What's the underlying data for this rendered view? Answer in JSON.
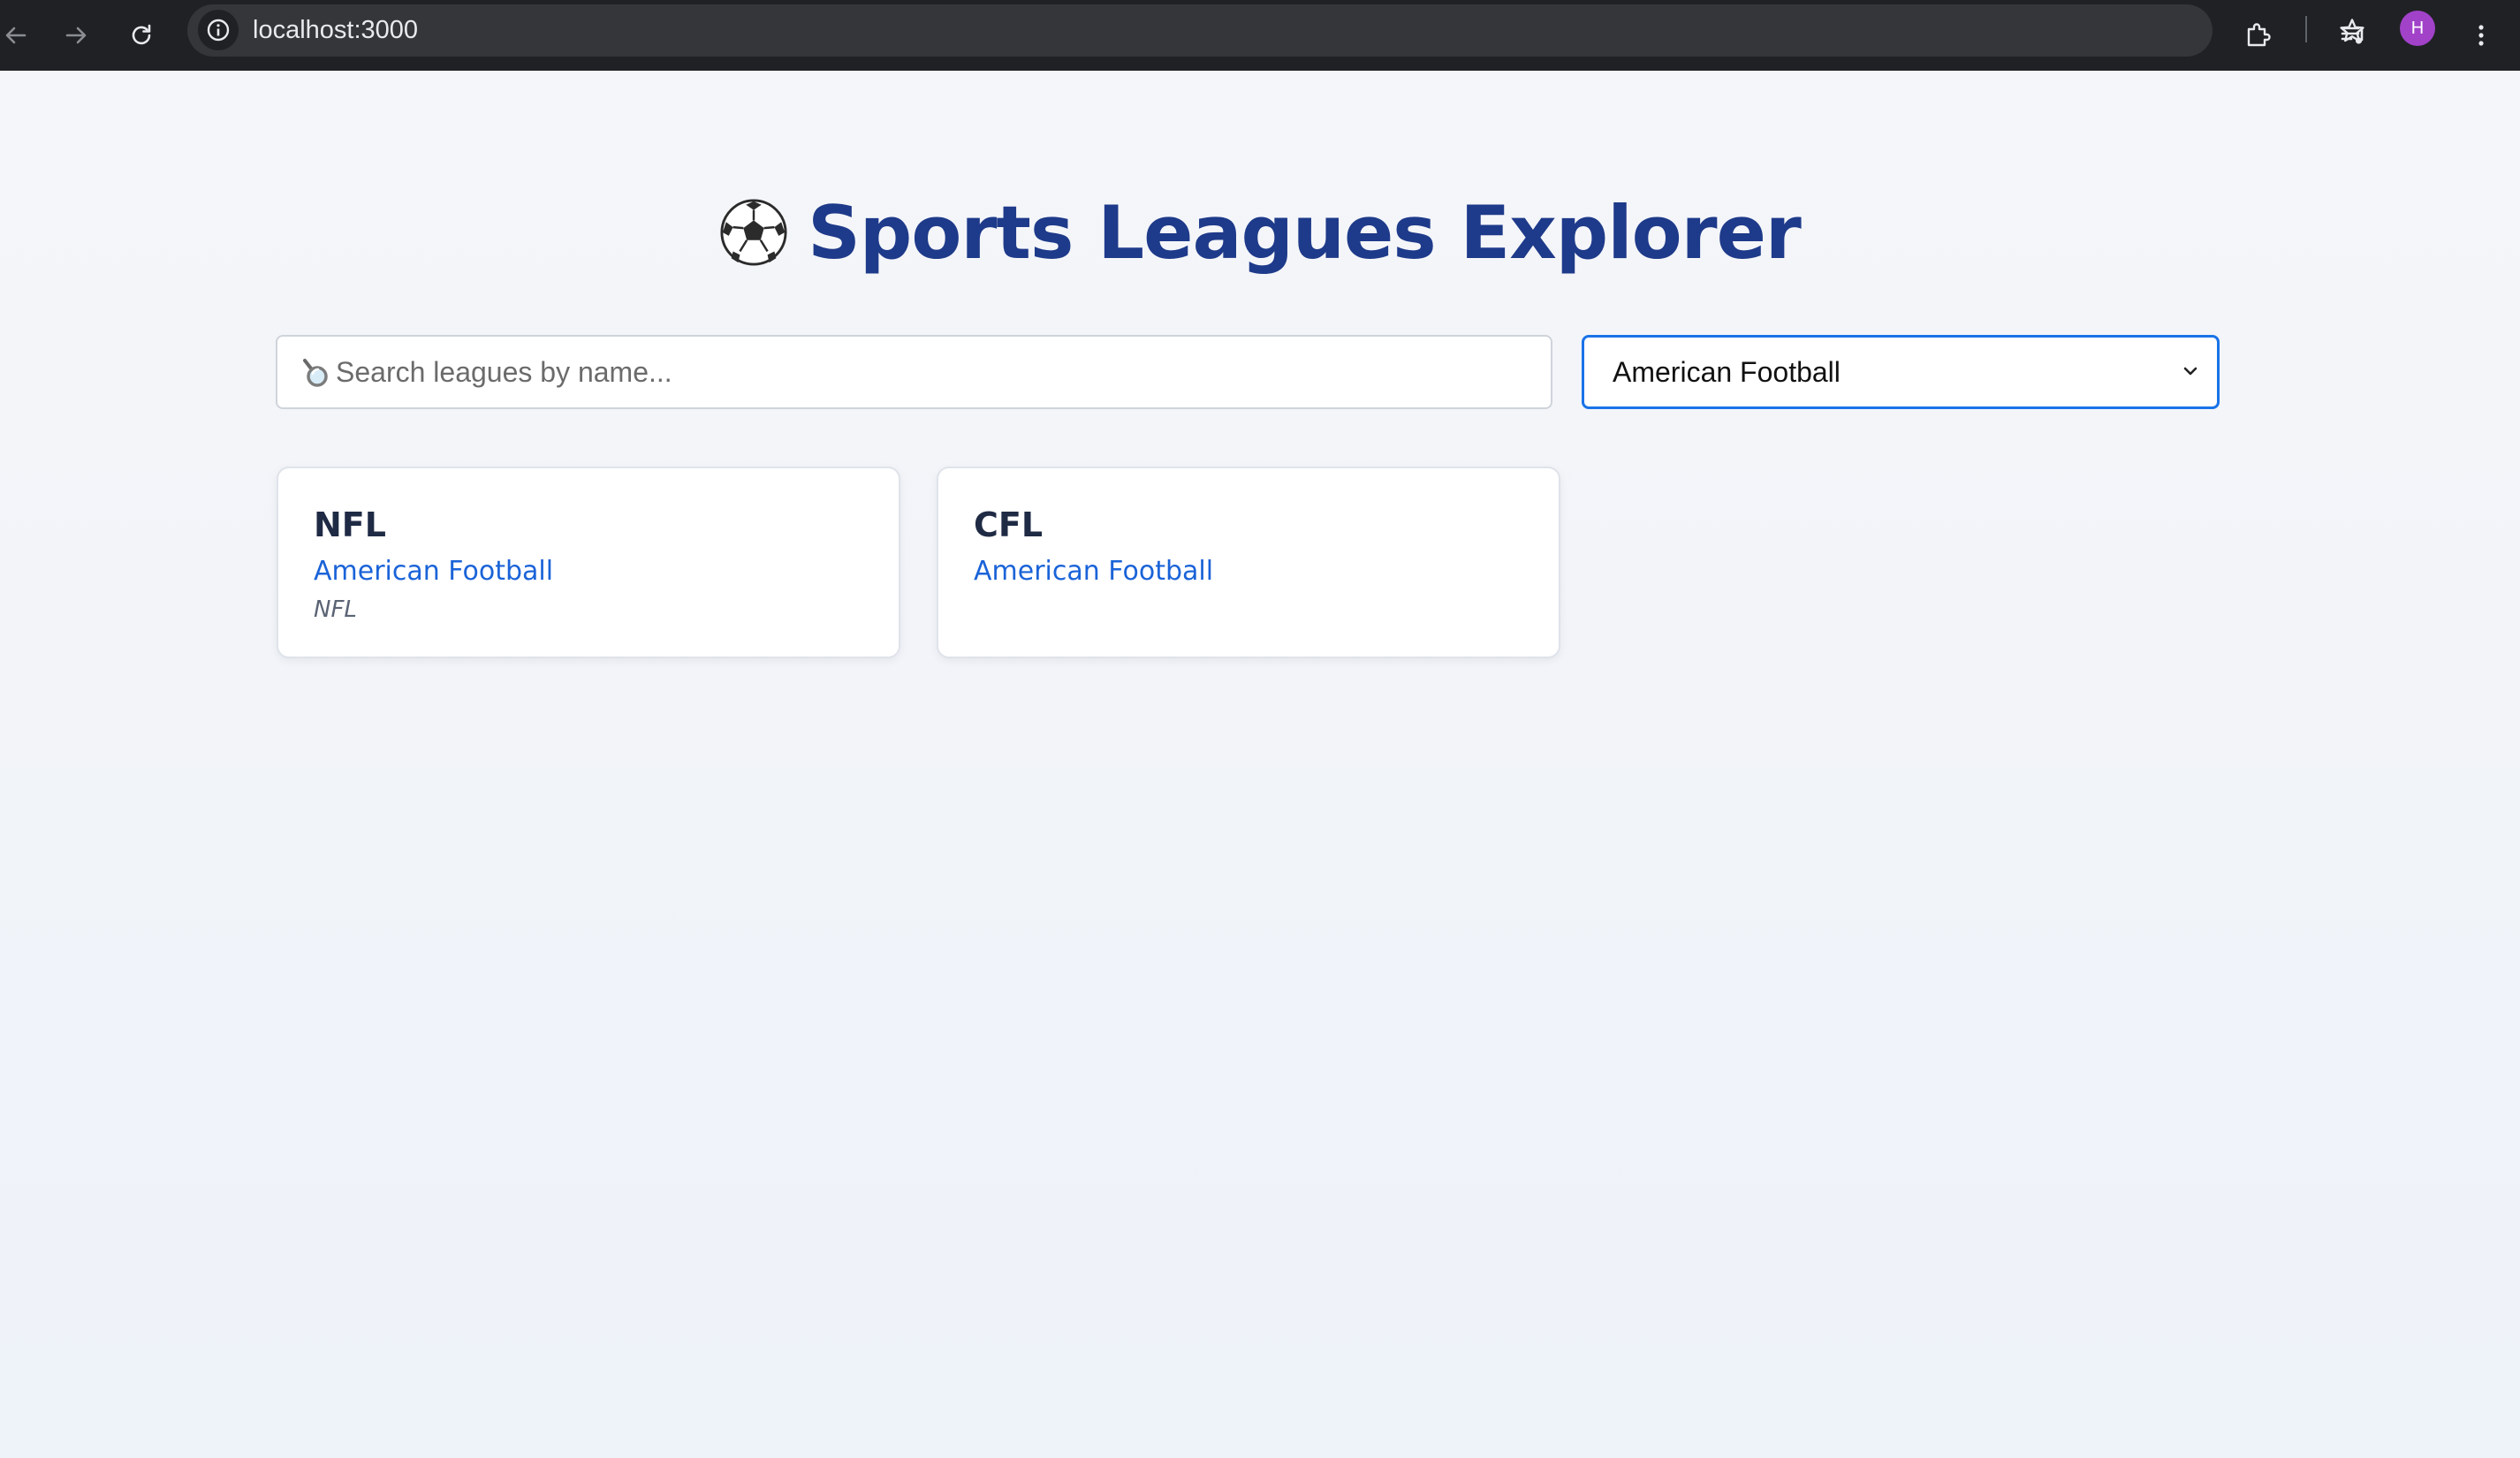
{
  "browser": {
    "url": "localhost:3000",
    "profile_initial": "H",
    "icons": {
      "back": "arrow-left-icon",
      "forward": "arrow-right-icon",
      "reload": "reload-icon",
      "site_info": "info-icon",
      "bookmark": "star-icon",
      "extensions": "puzzle-icon",
      "media": "media-queue-icon",
      "menu": "kebab-menu-icon"
    },
    "colors": {
      "toolbar": "#202124",
      "omnibox": "#35363a",
      "avatar": "#a142c9"
    }
  },
  "page": {
    "title_icon": "soccer-ball-icon",
    "title": "Sports Leagues Explorer",
    "colors": {
      "title": "#1e3a8a",
      "sport_link": "#1a63d8",
      "select_focus_border": "#1a73e8"
    }
  },
  "search": {
    "icon": "magnifier-icon",
    "placeholder": "Search leagues by name...",
    "value": ""
  },
  "filter": {
    "selected": "American Football"
  },
  "leagues": [
    {
      "name": "NFL",
      "sport": "American Football",
      "alternate": "NFL"
    },
    {
      "name": "CFL",
      "sport": "American Football",
      "alternate": ""
    }
  ]
}
